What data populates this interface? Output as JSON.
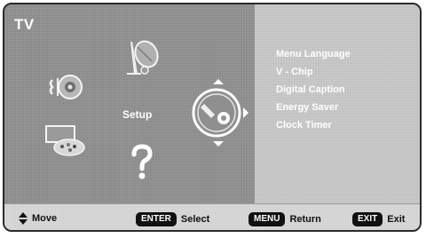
{
  "window": {
    "title": "TV"
  },
  "main": {
    "selected_label": "Setup",
    "icons": [
      "audio-speaker-icon",
      "satellite-dish-icon",
      "paint-palette-icon",
      "help-question-icon",
      "setup-gear-icon"
    ]
  },
  "submenu": {
    "items": [
      {
        "label": "Menu Language"
      },
      {
        "label": "V - Chip"
      },
      {
        "label": "Digital Caption"
      },
      {
        "label": "Energy Saver"
      },
      {
        "label": "Clock Timer"
      }
    ]
  },
  "footer": {
    "move_label": "Move",
    "enter_key": "ENTER",
    "enter_label": "Select",
    "menu_key": "MENU",
    "menu_label": "Return",
    "exit_key": "EXIT",
    "exit_label": "Exit"
  },
  "colors": {
    "left_pane": "#8c8c8c",
    "right_pane": "#c2c2c2",
    "text": "#ffffff",
    "key_bg": "#111111"
  }
}
